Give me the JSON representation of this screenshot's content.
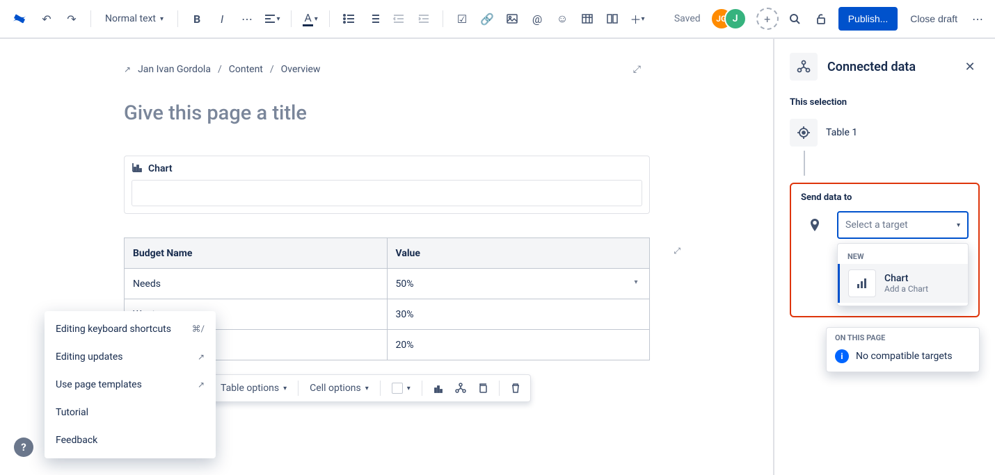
{
  "toolbar": {
    "text_style": "Normal text",
    "saved": "Saved",
    "avatar1": "JG",
    "avatar2": "J",
    "publish": "Publish...",
    "close_draft": "Close draft"
  },
  "breadcrumb": {
    "user": "Jan Ivan Gordola",
    "content": "Content",
    "overview": "Overview"
  },
  "title_placeholder": "Give this page a title",
  "chart_block": {
    "label": "Chart"
  },
  "table": {
    "headers": {
      "col1": "Budget Name",
      "col2": "Value"
    },
    "rows": {
      "r1": {
        "c1": "Needs",
        "c2": "50%"
      },
      "r2": {
        "c1": "Wants",
        "c2": "30%"
      },
      "r3": {
        "c1": "",
        "c2": "20%"
      }
    }
  },
  "table_toolbar": {
    "table_options": "Table options",
    "cell_options": "Cell options"
  },
  "help_menu": {
    "shortcuts": "Editing keyboard shortcuts",
    "shortcuts_key": "⌘/",
    "updates": "Editing updates",
    "templates": "Use page templates",
    "tutorial": "Tutorial",
    "feedback": "Feedback"
  },
  "panel": {
    "title": "Connected data",
    "this_selection": "This selection",
    "selected_name": "Table 1",
    "send_data_to": "Send data to",
    "select_placeholder": "Select a target",
    "dd_section_label": "NEW",
    "dd_chart_title": "Chart",
    "dd_chart_sub": "Add a Chart",
    "on_this_page": "ON THIS PAGE",
    "no_targets": "No compatible targets"
  }
}
